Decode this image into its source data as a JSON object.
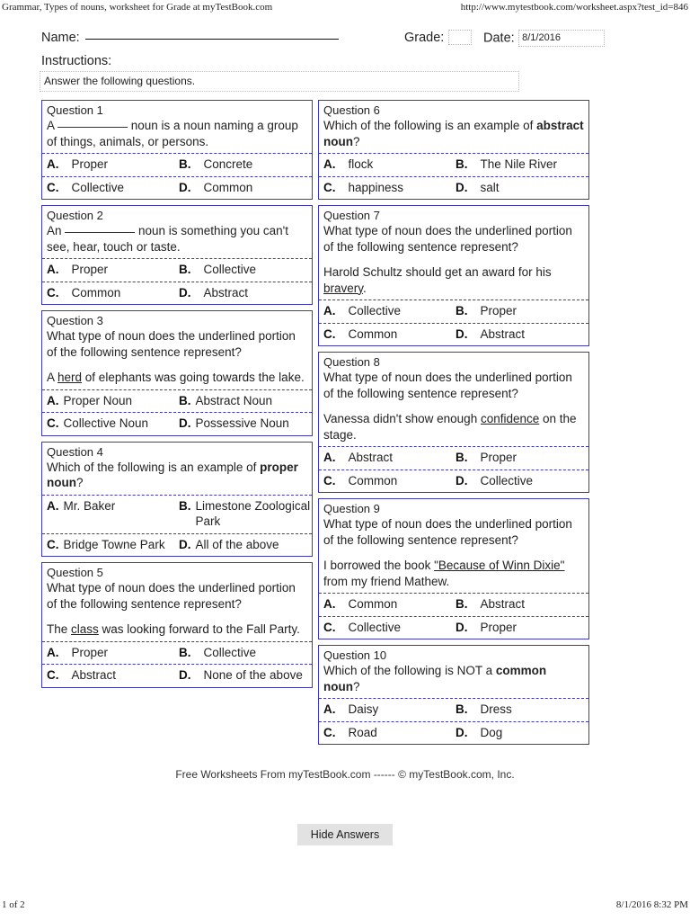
{
  "browser": {
    "header_title": "Grammar, Types of nouns, worksheet for Grade at myTestBook.com",
    "header_url": "http://www.mytestbook.com/worksheet.aspx?test_id=846",
    "footer_page": "1 of 2",
    "footer_timestamp": "8/1/2016 8:32 PM"
  },
  "form": {
    "name_label": "Name:",
    "name_value": "",
    "grade_label": "Grade:",
    "grade_value": "",
    "date_label": "Date:",
    "date_value": "8/1/2016",
    "instructions_label": "Instructions:",
    "instructions_value": "Answer the following questions."
  },
  "questions": [
    {
      "number": "Question 1",
      "stem_pre": "A ",
      "stem_post": " noun is a noun naming a group of things, animals, or persons.",
      "has_blank": true,
      "answers": [
        {
          "letter": "A.",
          "text": "Proper"
        },
        {
          "letter": "B.",
          "text": "Concrete"
        },
        {
          "letter": "C.",
          "text": "Collective"
        },
        {
          "letter": "D.",
          "text": "Common"
        }
      ]
    },
    {
      "number": "Question 2",
      "stem_pre": "An ",
      "stem_post": " noun is something you can't see, hear, touch or taste.",
      "has_blank": true,
      "answers": [
        {
          "letter": "A.",
          "text": "Proper"
        },
        {
          "letter": "B.",
          "text": "Collective"
        },
        {
          "letter": "C.",
          "text": "Common"
        },
        {
          "letter": "D.",
          "text": "Abstract"
        }
      ]
    },
    {
      "number": "Question 3",
      "prompt": "What type of noun does the underlined portion of the following sentence represent?",
      "sentence_pre": "A ",
      "sentence_underlined": "herd",
      "sentence_post": " of elephants was going towards the lake.",
      "answers": [
        {
          "letter": "A.",
          "text": "Proper Noun"
        },
        {
          "letter": "B.",
          "text": "Abstract Noun"
        },
        {
          "letter": "C.",
          "text": "Collective Noun"
        },
        {
          "letter": "D.",
          "text": "Possessive Noun"
        }
      ]
    },
    {
      "number": "Question 4",
      "prompt_pre": "Which of the following is an example of ",
      "prompt_bold": "proper noun",
      "prompt_post": "?",
      "answers": [
        {
          "letter": "A.",
          "text": "Mr. Baker"
        },
        {
          "letter": "B.",
          "text": "Limestone Zoological Park"
        },
        {
          "letter": "C.",
          "text": "Bridge Towne Park"
        },
        {
          "letter": "D.",
          "text": "All of the above"
        }
      ]
    },
    {
      "number": "Question 5",
      "prompt": "What type of noun does the underlined portion of the following sentence represent?",
      "sentence_pre": "The ",
      "sentence_underlined": "class",
      "sentence_post": " was looking forward to the Fall Party.",
      "answers": [
        {
          "letter": "A.",
          "text": "Proper"
        },
        {
          "letter": "B.",
          "text": "Collective"
        },
        {
          "letter": "C.",
          "text": "Abstract"
        },
        {
          "letter": "D.",
          "text": "None of the above"
        }
      ]
    },
    {
      "number": "Question 6",
      "prompt_pre": "Which of the following is an example of ",
      "prompt_bold": "abstract noun",
      "prompt_post": "?",
      "answers": [
        {
          "letter": "A.",
          "text": "flock"
        },
        {
          "letter": "B.",
          "text": "The Nile River"
        },
        {
          "letter": "C.",
          "text": "happiness"
        },
        {
          "letter": "D.",
          "text": "salt"
        }
      ]
    },
    {
      "number": "Question 7",
      "prompt": "What type of noun does the underlined portion of the following sentence represent?",
      "sentence_pre": "Harold Schultz should get an award for his ",
      "sentence_underlined": "bravery",
      "sentence_post": ".",
      "answers": [
        {
          "letter": "A.",
          "text": "Collective"
        },
        {
          "letter": "B.",
          "text": "Proper"
        },
        {
          "letter": "C.",
          "text": "Common"
        },
        {
          "letter": "D.",
          "text": "Abstract"
        }
      ]
    },
    {
      "number": "Question 8",
      "prompt": "What type of noun does the underlined portion of the following sentence represent?",
      "sentence_pre": "Vanessa didn't show enough ",
      "sentence_underlined": "confidence",
      "sentence_post": " on the stage.",
      "answers": [
        {
          "letter": "A.",
          "text": "Abstract"
        },
        {
          "letter": "B.",
          "text": "Proper"
        },
        {
          "letter": "C.",
          "text": "Common"
        },
        {
          "letter": "D.",
          "text": "Collective"
        }
      ]
    },
    {
      "number": "Question 9",
      "prompt": "What type of noun does the underlined portion of the following sentence represent?",
      "sentence_pre": "I borrowed the book ",
      "sentence_underlined": "\"Because of Winn Dixie\"",
      "sentence_post": " from my friend Mathew.",
      "answers": [
        {
          "letter": "A.",
          "text": "Common"
        },
        {
          "letter": "B.",
          "text": "Abstract"
        },
        {
          "letter": "C.",
          "text": "Collective"
        },
        {
          "letter": "D.",
          "text": "Proper"
        }
      ]
    },
    {
      "number": "Question 10",
      "prompt_pre": "Which of the following is NOT a ",
      "prompt_bold": "common noun",
      "prompt_post": "?",
      "answers": [
        {
          "letter": "A.",
          "text": "Daisy"
        },
        {
          "letter": "B.",
          "text": "Dress"
        },
        {
          "letter": "C.",
          "text": "Road"
        },
        {
          "letter": "D.",
          "text": "Dog"
        }
      ]
    }
  ],
  "worksheet_footer": "Free Worksheets From myTestBook.com ------ © myTestBook.com, Inc.",
  "hide_answers_label": "Hide Answers",
  "colors": {
    "box_border": "#3c3cb0",
    "button_bg": "#e2e2e2"
  }
}
